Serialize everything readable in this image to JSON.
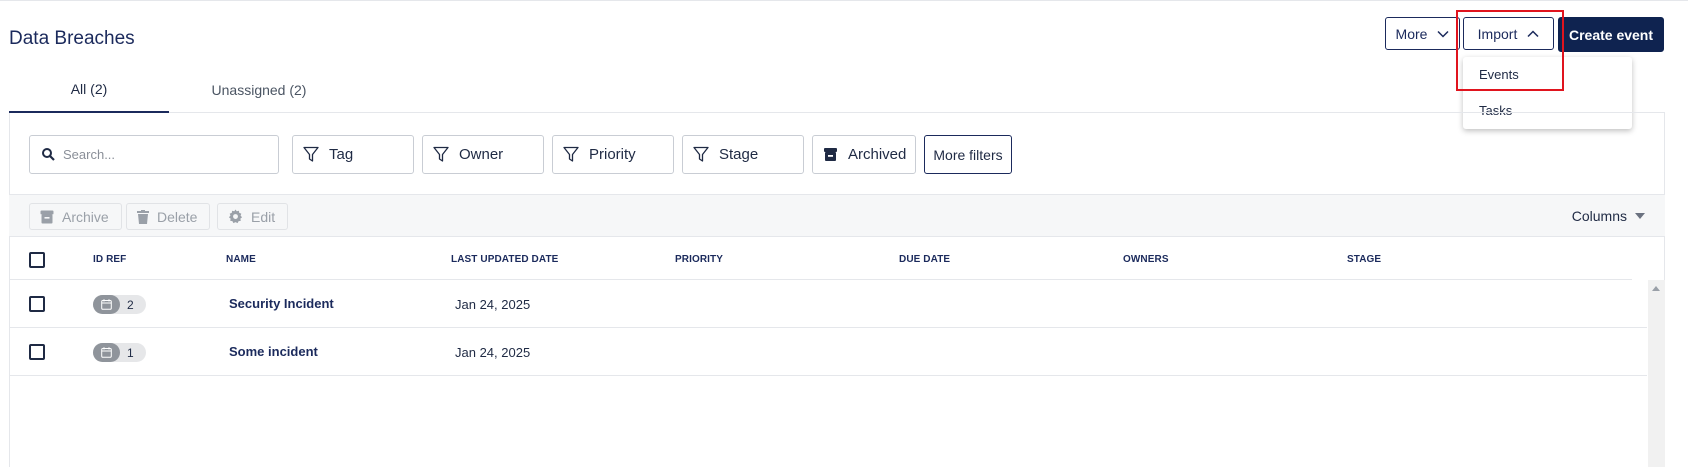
{
  "page": {
    "title": "Data Breaches"
  },
  "header_actions": {
    "more_label": "More",
    "import_label": "Import",
    "create_label": "Create event",
    "import_menu": [
      "Events",
      "Tasks"
    ]
  },
  "tabs": [
    {
      "label": "All (2)",
      "active": true
    },
    {
      "label": "Unassigned (2)",
      "active": false
    }
  ],
  "search": {
    "placeholder": "Search...",
    "value": ""
  },
  "filters": {
    "tag": "Tag",
    "owner": "Owner",
    "priority": "Priority",
    "stage": "Stage",
    "archived": "Archived",
    "more": "More filters"
  },
  "toolbar": {
    "archive": "Archive",
    "delete": "Delete",
    "edit": "Edit",
    "columns": "Columns"
  },
  "table": {
    "columns": [
      "ID REF",
      "NAME",
      "LAST UPDATED DATE",
      "PRIORITY",
      "DUE DATE",
      "OWNERS",
      "STAGE"
    ],
    "rows": [
      {
        "id": "2",
        "name": "Security Incident",
        "updated": "Jan 24, 2025",
        "priority": "",
        "due": "",
        "owners": "",
        "stage": ""
      },
      {
        "id": "1",
        "name": "Some incident",
        "updated": "Jan 24, 2025",
        "priority": "",
        "due": "",
        "owners": "",
        "stage": ""
      }
    ]
  },
  "colors": {
    "brand": "#0f2350",
    "highlight": "#e0141e"
  }
}
